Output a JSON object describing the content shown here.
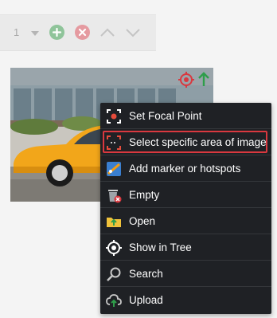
{
  "toolbar": {
    "select_value": "1"
  },
  "context_menu": {
    "items": [
      {
        "label": "Set Focal Point",
        "icon": "focal-point-icon"
      },
      {
        "label": "Select specific area of image",
        "icon": "crop-area-icon",
        "highlighted": true
      },
      {
        "label": "Add marker or hotspots",
        "icon": "marker-hotspot-icon"
      },
      {
        "label": "Empty",
        "icon": "trash-icon"
      },
      {
        "label": "Open",
        "icon": "folder-open-icon"
      },
      {
        "label": "Show in Tree",
        "icon": "target-icon"
      },
      {
        "label": "Search",
        "icon": "search-icon"
      },
      {
        "label": "Upload",
        "icon": "cloud-upload-icon"
      }
    ]
  },
  "colors": {
    "menu_background": "#1f2125",
    "highlight_border": "#d9383f",
    "add_green": "#8fc49a",
    "remove_red": "#e59aa0"
  }
}
